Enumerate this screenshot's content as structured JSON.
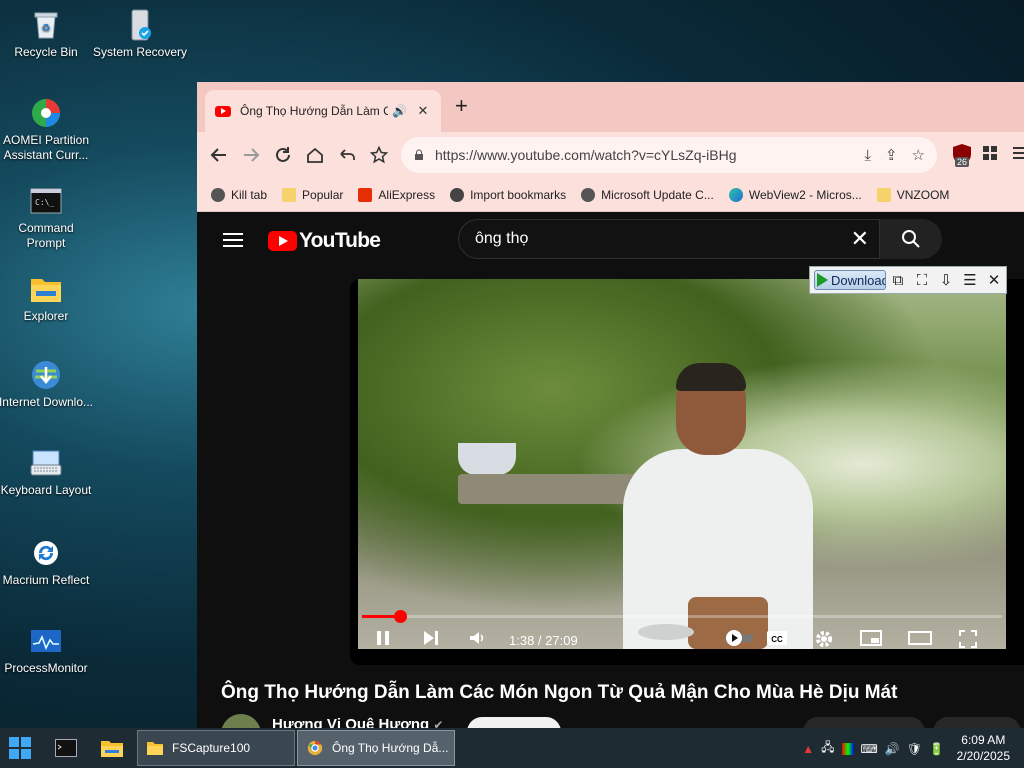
{
  "desktop": {
    "icons": [
      {
        "label": "Recycle Bin"
      },
      {
        "label": "System Recovery"
      },
      {
        "label": "AOMEI Partition Assistant Curr..."
      },
      {
        "label": "Command Prompt"
      },
      {
        "label": "Explorer"
      },
      {
        "label": "Internet Downlo..."
      },
      {
        "label": "Keyboard Layout"
      },
      {
        "label": "Macrium Reflect"
      },
      {
        "label": "ProcessMonitor"
      }
    ]
  },
  "browser": {
    "tab": {
      "title": "Ông Thọ Hướng Dẫn Làm C",
      "audio_icon": "speaker-icon",
      "close": "✕"
    },
    "new_tab": "+",
    "url": "https://www.youtube.com/watch?v=cYLsZq-iBHg",
    "extension_badge": "26",
    "bookmarks": [
      {
        "label": "Kill tab"
      },
      {
        "label": "Popular"
      },
      {
        "label": "AliExpress"
      },
      {
        "label": "Import bookmarks"
      },
      {
        "label": "Microsoft Update C..."
      },
      {
        "label": "WebView2 - Micros..."
      },
      {
        "label": "VNZOOM"
      }
    ]
  },
  "youtube": {
    "logo_text": "YouTube",
    "search_value": "ông thọ",
    "download_panel": {
      "button_label": "Download"
    },
    "player": {
      "time": "1:38 / 27:09",
      "progress_fraction": 0.06
    },
    "video_title": "Ông Thọ Hướng Dẫn Làm Các Món Ngon Từ Quả Mận Cho Mùa Hè Dịu Mát",
    "channel_name": "Hương Vị Quê Hương"
  },
  "taskbar": {
    "tasks": [
      {
        "label": "FSCapture100"
      },
      {
        "label": "Ông Thọ Hướng Dẫ..."
      }
    ],
    "clock": {
      "time": "6:09 AM",
      "date": "2/20/2025"
    }
  },
  "colors": {
    "accent_red": "#ff0000",
    "tab_strip": "#f3c7c2",
    "toolbar": "#fbe0dc"
  }
}
